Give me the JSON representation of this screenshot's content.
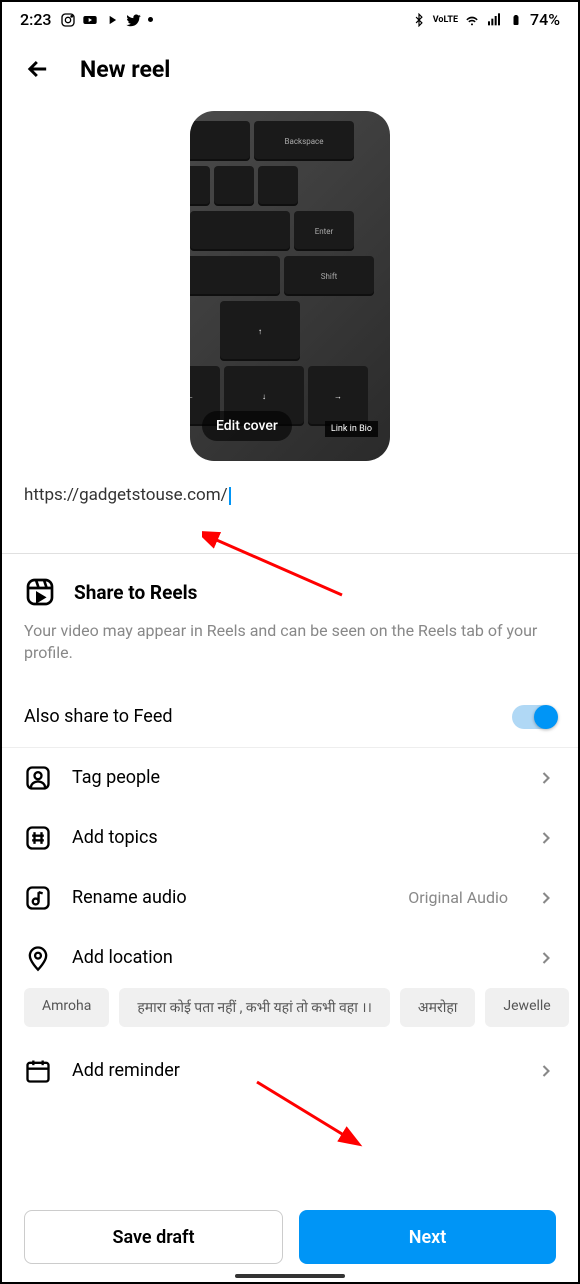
{
  "status_bar": {
    "time": "2:23",
    "battery_pct": "74%"
  },
  "header": {
    "title": "New reel"
  },
  "cover": {
    "edit_cover_label": "Edit cover",
    "linkinbio_label": "Link in Bio"
  },
  "caption": {
    "text": "https://gadgetstouse.com/"
  },
  "sharing": {
    "title": "Share to Reels",
    "description": "Your video may appear in Reels and can be seen on the Reels tab of your profile.",
    "feed_label": "Also share to Feed",
    "feed_enabled": true
  },
  "options": {
    "tag_people": "Tag people",
    "add_topics": "Add topics",
    "rename_audio": "Rename audio",
    "rename_audio_value": "Original Audio",
    "add_location": "Add location",
    "add_reminder": "Add reminder"
  },
  "location_suggestions": [
    "Amroha",
    "हमारा कोई पता नहीं , कभी यहां तो कभी वहा ।।",
    "अमरोहा",
    "Jewelle"
  ],
  "buttons": {
    "save_draft": "Save draft",
    "next": "Next"
  }
}
